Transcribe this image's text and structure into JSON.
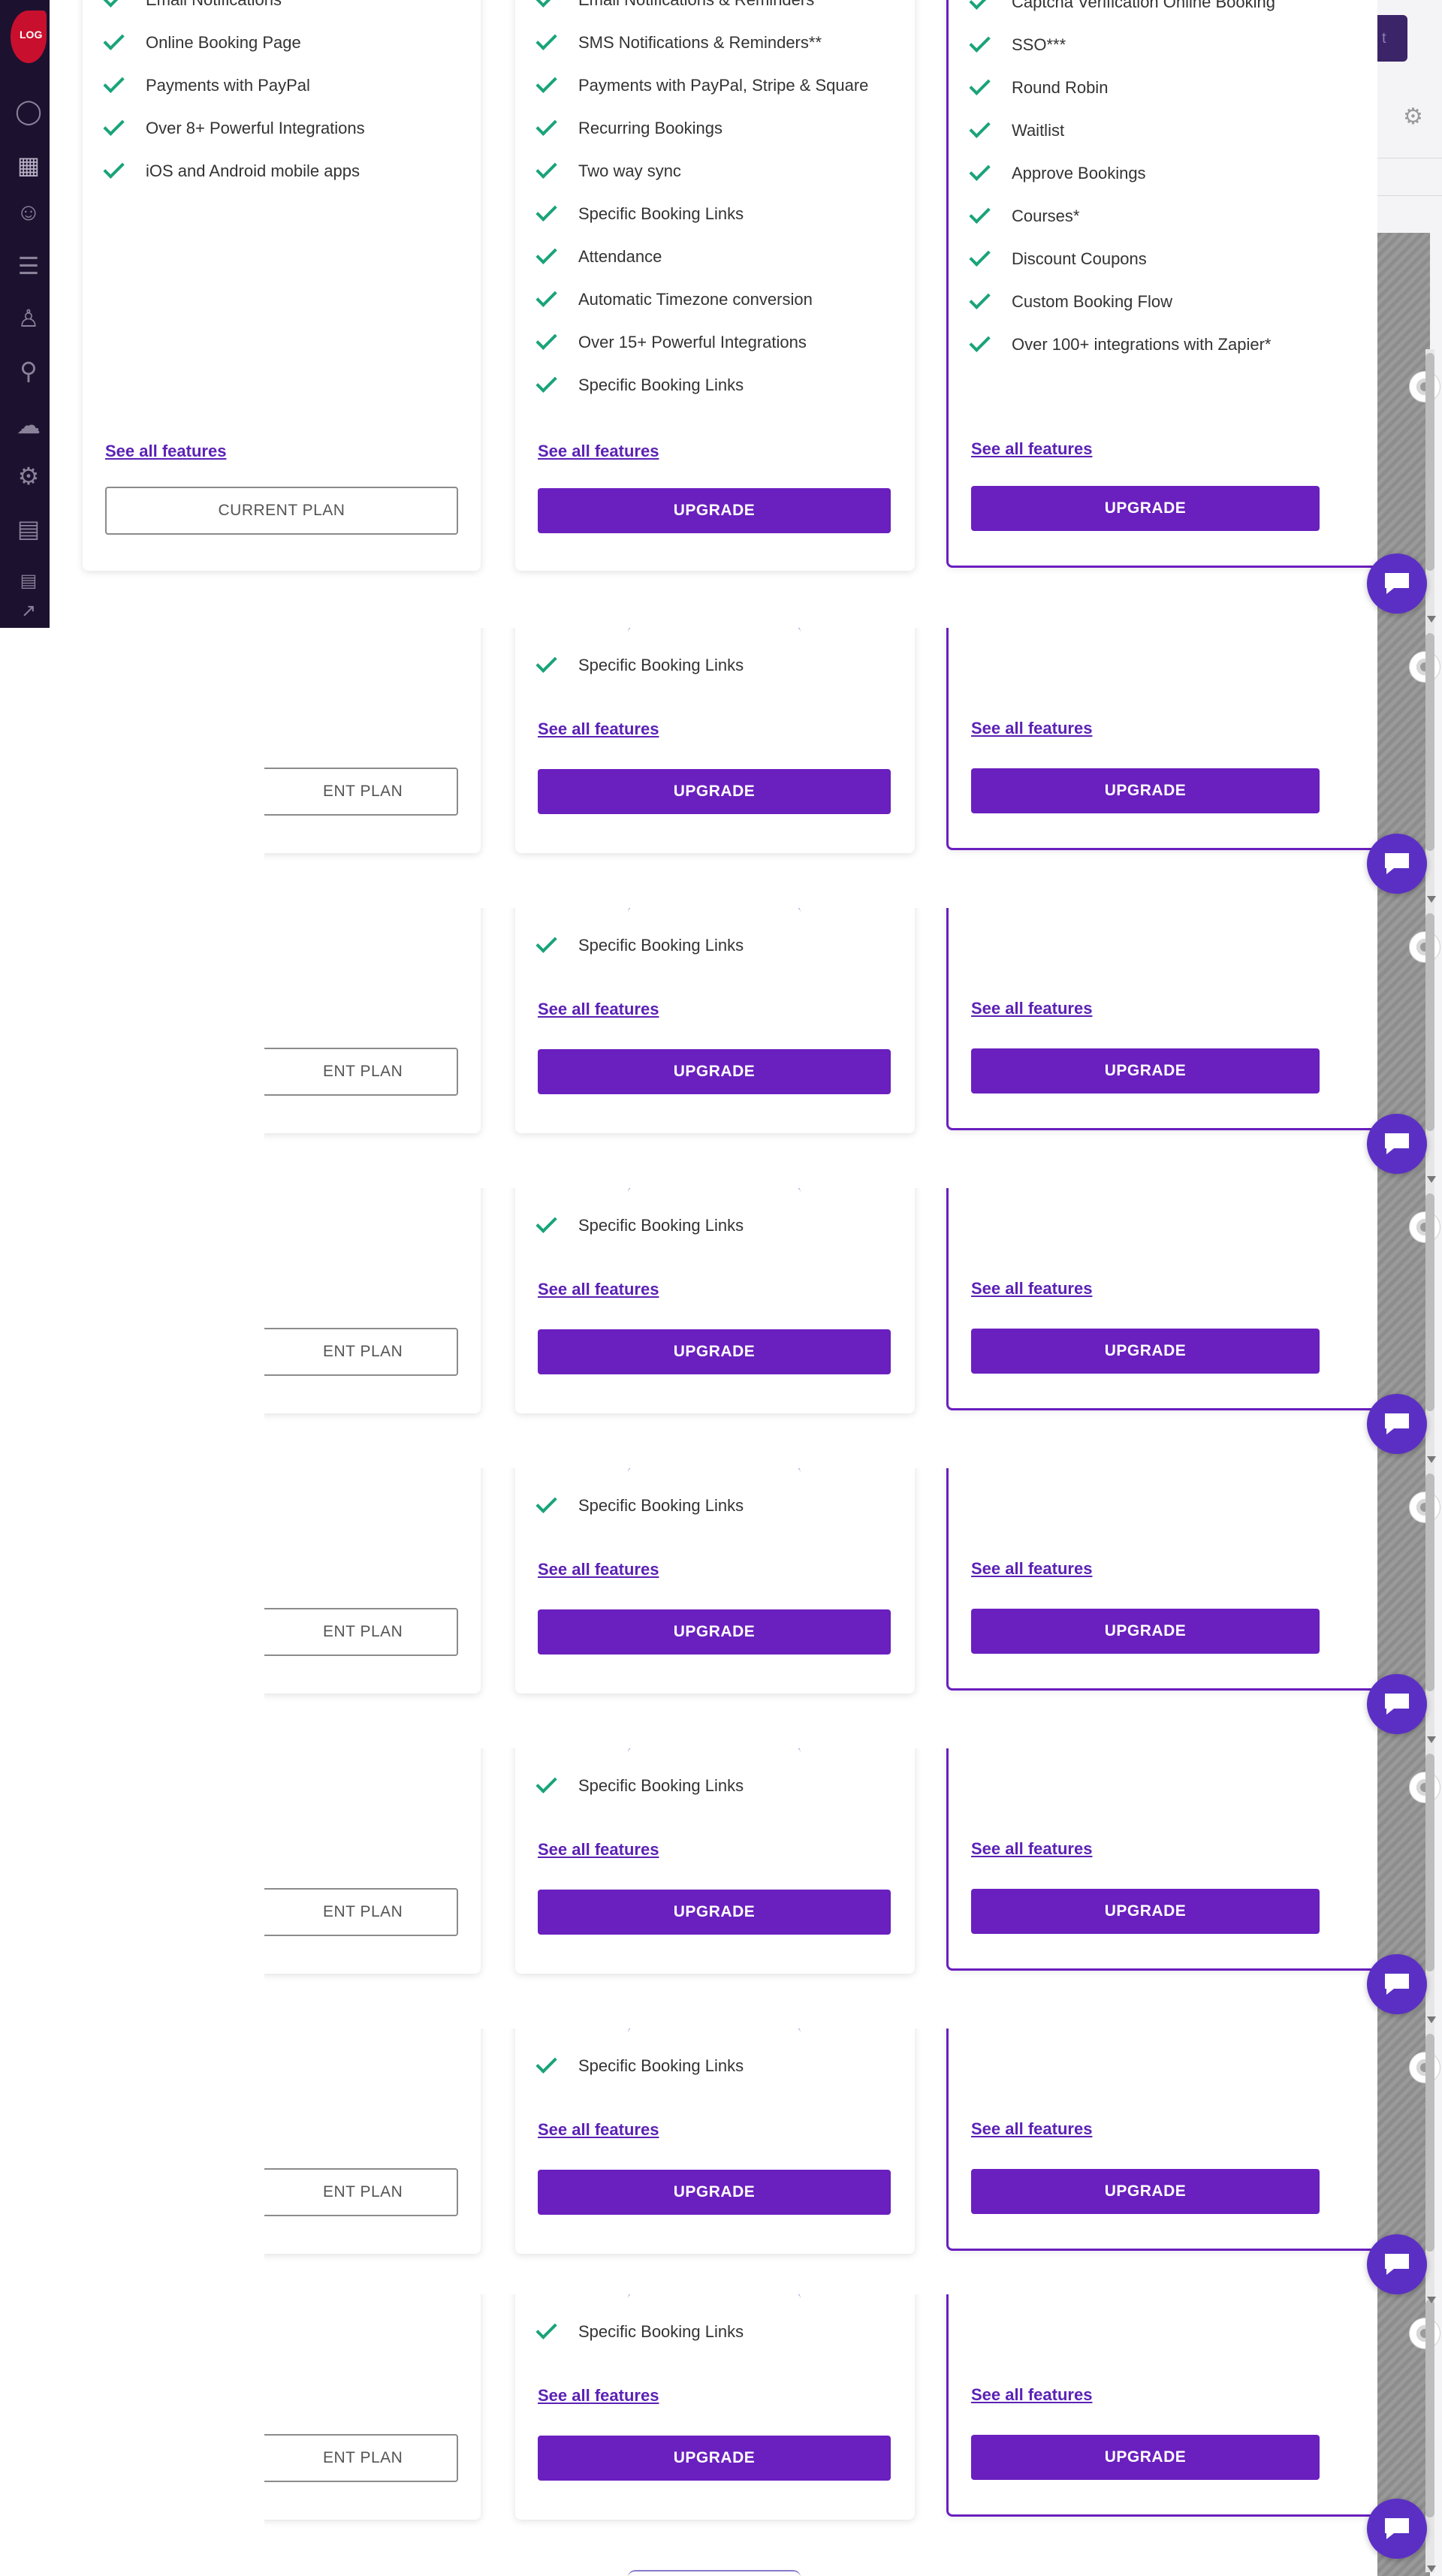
{
  "sidebar": {
    "logo_text": "LOG",
    "icons": [
      "globe-icon",
      "calendar-icon",
      "team-icon",
      "list-icon",
      "person-icon",
      "location-icon",
      "cloud-icon",
      "gear-icon",
      "chart-icon",
      "id-card-icon",
      "external-link-icon"
    ]
  },
  "plans": {
    "basic": {
      "features": [
        "Email Notifications",
        "Online Booking Page",
        "Payments with PayPal",
        "Over 8+ Powerful Integrations",
        "iOS and Android mobile apps"
      ],
      "see_all_label": "See all features",
      "button_label": "CURRENT PLAN",
      "button_partial_label": "ENT PLAN"
    },
    "pro": {
      "features": [
        "Email Notifications & Reminders",
        "SMS Notifications & Reminders**",
        "Payments with PayPal, Stripe & Square",
        "Recurring Bookings",
        "Two way sync",
        "Specific Booking Links",
        "Attendance",
        "Automatic Timezone conversion",
        "Over 15+ Powerful Integrations",
        "Specific Booking Links"
      ],
      "see_all_label": "See all features",
      "button_label": "UPGRADE"
    },
    "enterprise": {
      "features": [
        "Captcha Verification Online Booking",
        "SSO***",
        "Round Robin",
        "Waitlist",
        "Approve Bookings",
        "Courses*",
        "Discount Coupons",
        "Custom Booking Flow",
        "Over 100+ integrations with Zapier*"
      ],
      "see_all_label": "See all features",
      "button_label": "UPGRADE"
    }
  },
  "repeat_feature_label": "Specific Booking Links",
  "colors": {
    "accent": "#6a1fbf",
    "check": "#1aa37a",
    "link": "#5b22b5",
    "sidebar": "#1c1230",
    "chat": "#5b2fc4"
  }
}
